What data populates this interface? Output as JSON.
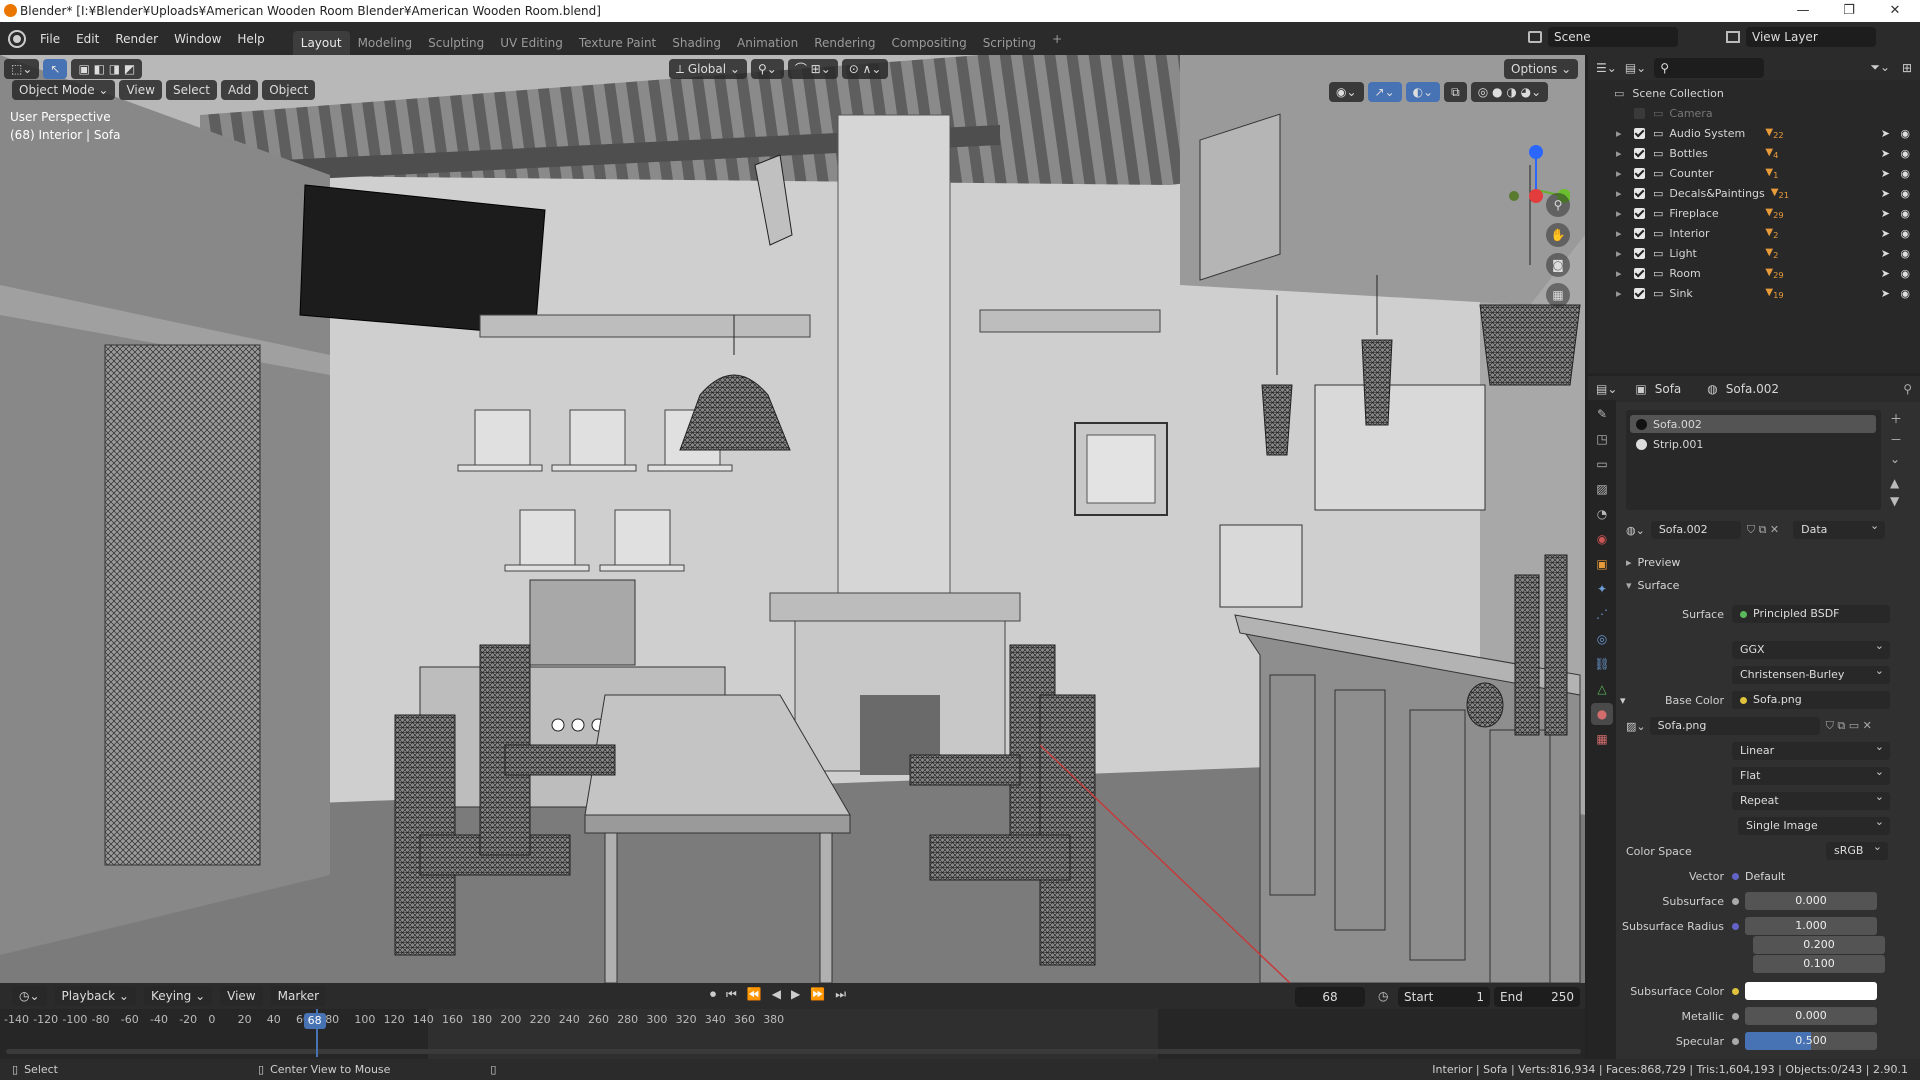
{
  "window": {
    "title": "Blender* [I:¥Blender¥Uploads¥American Wooden Room Blender¥American Wooden Room.blend]",
    "minimize": "—",
    "maximize": "❐",
    "close": "✕"
  },
  "menu": [
    "File",
    "Edit",
    "Render",
    "Window",
    "Help"
  ],
  "workspaces": [
    "Layout",
    "Modeling",
    "Sculpting",
    "UV Editing",
    "Texture Paint",
    "Shading",
    "Animation",
    "Rendering",
    "Compositing",
    "Scripting"
  ],
  "active_workspace": "Layout",
  "add_workspace": "+",
  "scene": {
    "label": "Scene"
  },
  "view_layer": {
    "label": "View Layer"
  },
  "viewport_header": {
    "mode": "Object Mode",
    "view": "View",
    "select": "Select",
    "add": "Add",
    "object": "Object",
    "transform": "Global",
    "options": "Options"
  },
  "viewport_info": {
    "line1": "User Perspective",
    "line2": "(68) Interior | Sofa"
  },
  "outliner": {
    "root": "Scene Collection",
    "items": [
      {
        "name": "Camera",
        "enabled": false,
        "badge": ""
      },
      {
        "name": "Audio System",
        "enabled": true,
        "badge": "22"
      },
      {
        "name": "Bottles",
        "enabled": true,
        "badge": "4"
      },
      {
        "name": "Counter",
        "enabled": true,
        "badge": "1"
      },
      {
        "name": "Decals&Paintings",
        "enabled": true,
        "badge": "21"
      },
      {
        "name": "Fireplace",
        "enabled": true,
        "badge": "29"
      },
      {
        "name": "Interior",
        "enabled": true,
        "badge": "2"
      },
      {
        "name": "Light",
        "enabled": true,
        "badge": "2"
      },
      {
        "name": "Room",
        "enabled": true,
        "badge": "29"
      },
      {
        "name": "Sink",
        "enabled": true,
        "badge": "19"
      }
    ]
  },
  "properties": {
    "object_name": "Sofa",
    "material_name": "Sofa.002",
    "slots": [
      "Sofa.002",
      "Strip.001"
    ],
    "material_field": "Sofa.002",
    "data_dropdown": "Data",
    "panels": {
      "preview": "Preview",
      "surface": "Surface"
    },
    "rows": {
      "surface_label": "Surface",
      "surface_value": "Principled BSDF",
      "distribution": "GGX",
      "subsurface_method": "Christensen-Burley",
      "base_color_label": "Base Color",
      "base_color_value": "Sofa.png",
      "image_name": "Sofa.png",
      "interpolation": "Linear",
      "projection": "Flat",
      "extension": "Repeat",
      "source": "Single Image",
      "color_space_label": "Color Space",
      "color_space_value": "sRGB",
      "vector_label": "Vector",
      "vector_value": "Default",
      "subsurface_label": "Subsurface",
      "subsurface_value": "0.000",
      "subsurface_radius_label": "Subsurface Radius",
      "subsurface_radius": [
        "1.000",
        "0.200",
        "0.100"
      ],
      "subsurface_color_label": "Subsurface Color",
      "metallic_label": "Metallic",
      "metallic_value": "0.000",
      "specular_label": "Specular",
      "specular_value": "0.500"
    },
    "specular_fraction": 0.5
  },
  "timeline": {
    "playback": "Playback",
    "keying": "Keying",
    "view": "View",
    "marker": "Marker",
    "current_frame": "68",
    "start_label": "Start",
    "start_value": "1",
    "end_label": "End",
    "end_value": "250",
    "ticks": [
      "-140",
      "-120",
      "-100",
      "-80",
      "-60",
      "-40",
      "-20",
      "0",
      "20",
      "40",
      "60",
      "80",
      "100",
      "120",
      "140",
      "160",
      "180",
      "200",
      "220",
      "240",
      "260",
      "280",
      "300",
      "320",
      "340",
      "360",
      "380"
    ],
    "playhead": "68"
  },
  "status": {
    "select": "Select",
    "center_view": "Center View to Mouse",
    "stats": "Interior | Sofa | Verts:816,934 | Faces:868,729 | Tris:1,604,193 | Objects:0/243 | 2.90.1"
  },
  "colors": {
    "accent": "#4772b3",
    "viewport_bg": "#6a6a6a",
    "panel_bg": "#303030",
    "header_bg": "#2b2b2b"
  }
}
